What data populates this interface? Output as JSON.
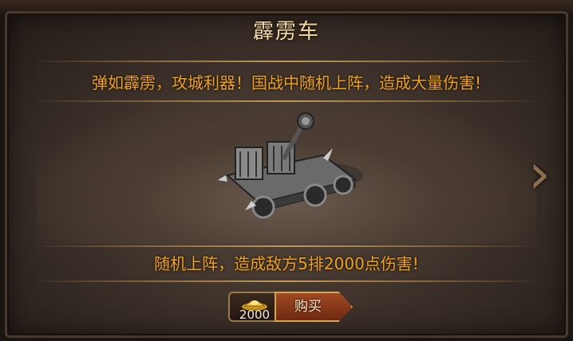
{
  "dialog": {
    "title": "霹雳车",
    "description": "弹如霹雳，攻城利器！国战中随机上阵，造成大量伤害!",
    "effect": "随机上阵，造成敌方5排2000点伤害!",
    "next_icon": "chevron-right-icon",
    "item_icon": "catapult-siege-weapon"
  },
  "purchase": {
    "currency_icon": "gold-ingot-icon",
    "price": "2000",
    "buy_label": "购买"
  },
  "colors": {
    "title": "#f2d7a6",
    "accent_text": "#f0a020",
    "button": "#a14a22"
  }
}
